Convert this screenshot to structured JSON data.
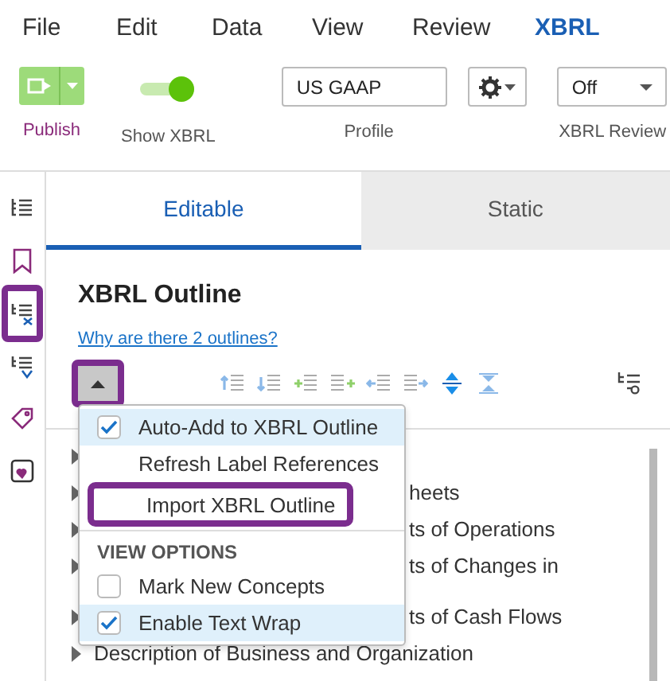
{
  "menu_bar": [
    {
      "label": "File",
      "selected": false
    },
    {
      "label": "Edit",
      "selected": false
    },
    {
      "label": "Data",
      "selected": false
    },
    {
      "label": "View",
      "selected": false
    },
    {
      "label": "Review",
      "selected": false
    },
    {
      "label": "XBRL",
      "selected": true
    }
  ],
  "ribbon": {
    "publish": {
      "label": "Publish"
    },
    "show_xbrl": {
      "label": "Show XBRL",
      "on": true
    },
    "profile": {
      "value": "US GAAP",
      "label": "Profile"
    },
    "xbrl_review": {
      "value": "Off",
      "label": "XBRL Review"
    }
  },
  "sidebar": {
    "items": [
      {
        "kind": "tree",
        "highlighted": false
      },
      {
        "kind": "bookmark",
        "highlighted": false
      },
      {
        "kind": "tree-x",
        "highlighted": true
      },
      {
        "kind": "tree-check",
        "highlighted": false
      },
      {
        "kind": "tags",
        "highlighted": false
      },
      {
        "kind": "note",
        "highlighted": false
      }
    ]
  },
  "tabs": [
    {
      "label": "Editable",
      "selected": true
    },
    {
      "label": "Static",
      "selected": false
    }
  ],
  "panel": {
    "title": "XBRL Outline",
    "help_link": "Why are there 2 outlines?",
    "menu_button": {
      "expanded": true,
      "highlighted": true
    }
  },
  "outline": [
    {
      "expandable": true
    },
    {
      "label": "heets",
      "expandable": true,
      "partly_hidden": true
    },
    {
      "label": "ts of Operations",
      "expandable": true,
      "partly_hidden": true
    },
    {
      "label": "ts of Changes in",
      "expandable": true,
      "partly_hidden": true,
      "wrapped": true
    },
    {
      "label": "ts of Cash Flows",
      "expandable": true,
      "partly_hidden": true
    },
    {
      "label": "Description of Business and Organization",
      "expandable": true,
      "partly_hidden": false
    }
  ],
  "dropdown": {
    "sections": [
      {
        "items": [
          {
            "kind": "checkbox",
            "label": "Auto-Add to XBRL Outline",
            "checked": true,
            "highlighted": false
          },
          {
            "kind": "command",
            "label": "Refresh Label References",
            "highlighted": false
          },
          {
            "kind": "command",
            "label": "Import XBRL Outline",
            "highlighted": true
          }
        ]
      },
      {
        "heading": "VIEW OPTIONS",
        "items": [
          {
            "kind": "checkbox",
            "label": "Mark New Concepts",
            "checked": false,
            "highlighted": false
          },
          {
            "kind": "checkbox",
            "label": "Enable Text Wrap",
            "checked": true,
            "highlighted": false
          }
        ]
      }
    ]
  }
}
